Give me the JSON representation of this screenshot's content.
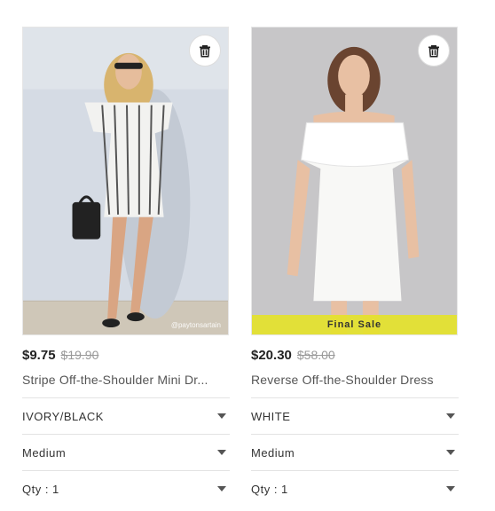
{
  "products": [
    {
      "price": "$9.75",
      "original_price": "$19.90",
      "title": "Stripe Off-the-Shoulder Mini Dr...",
      "image_watermark": "@paytonsartain",
      "color": "IVORY/BLACK",
      "size": "Medium",
      "qty": "Qty : 1"
    },
    {
      "price": "$20.30",
      "original_price": "$58.00",
      "title": "Reverse Off-the-Shoulder Dress",
      "badge": "Final Sale",
      "color": "WHITE",
      "size": "Medium",
      "qty": "Qty : 1"
    }
  ],
  "icons": {
    "remove": "trash-icon",
    "dropdown": "chevron-down-icon"
  },
  "colors": {
    "final_sale_banner": "#e4e228",
    "strike_price": "#999999"
  }
}
